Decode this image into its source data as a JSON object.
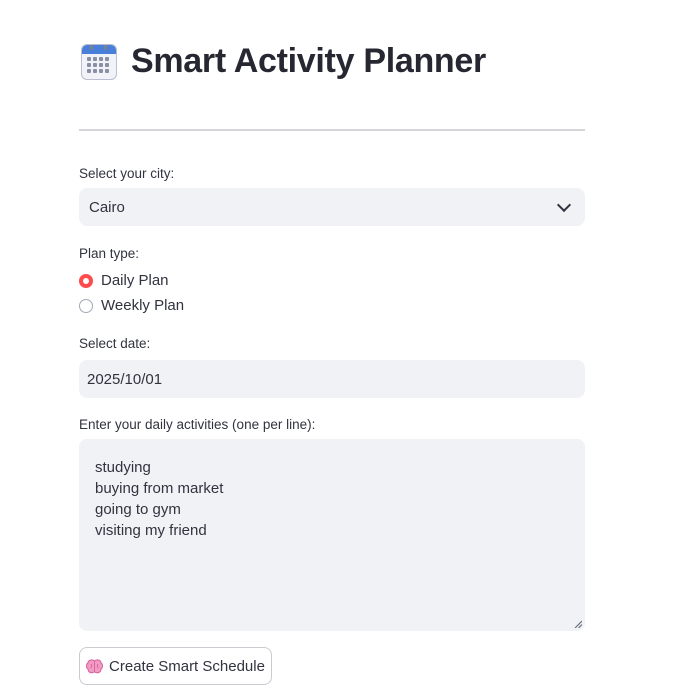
{
  "header": {
    "title": "Smart Activity Planner",
    "icon": "calendar-icon"
  },
  "city": {
    "label": "Select your city:",
    "value": "Cairo"
  },
  "plan_type": {
    "label": "Plan type:",
    "options": [
      {
        "label": "Daily Plan",
        "selected": true
      },
      {
        "label": "Weekly Plan",
        "selected": false
      }
    ]
  },
  "date": {
    "label": "Select date:",
    "value": "2025/10/01"
  },
  "activities": {
    "label": "Enter your daily activities (one per line):",
    "lines": [
      "studying",
      "buying from market",
      "going to gym",
      "visiting my friend"
    ]
  },
  "action": {
    "label": "Create Smart Schedule",
    "icon": "brain-icon"
  },
  "colors": {
    "accent": "#ff4b4b",
    "input_bg": "#f0f2f6",
    "text": "#31333f"
  }
}
